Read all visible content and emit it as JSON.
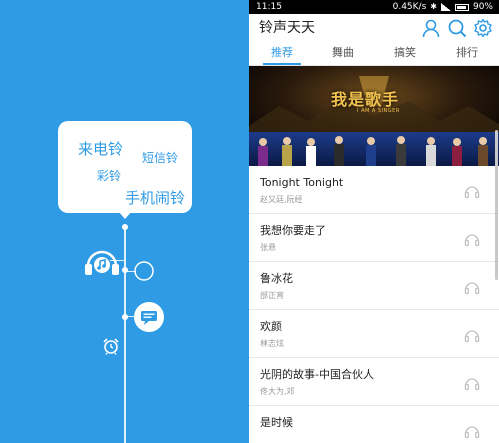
{
  "promo": {
    "bubble_words": [
      "来电铃",
      "短信铃",
      "彩铃",
      "手机闹铃"
    ]
  },
  "status_bar": {
    "time": "11:15",
    "network_speed": "0.45K/s",
    "battery": "90%"
  },
  "header": {
    "title": "铃声天天",
    "icons": [
      "user-icon",
      "search-icon",
      "gear-icon"
    ]
  },
  "tabs": [
    {
      "label": "推荐",
      "active": true
    },
    {
      "label": "舞曲",
      "active": false
    },
    {
      "label": "搞笑",
      "active": false
    },
    {
      "label": "排行",
      "active": false
    }
  ],
  "banner": {
    "logo_text": "我是歌手",
    "logo_subtext": "I AM A SINGER"
  },
  "songs": [
    {
      "title": "Tonight Tonight",
      "artist": "赵又廷,阮经"
    },
    {
      "title": "我想你要走了",
      "artist": "张悬"
    },
    {
      "title": "鲁冰花",
      "artist": "邰正宵"
    },
    {
      "title": "欢颜",
      "artist": "林志炫"
    },
    {
      "title": "光阴的故事-中国合伙人",
      "artist": "佟大为,邓"
    },
    {
      "title": "是时候",
      "artist": ""
    }
  ],
  "colors": {
    "accent": "#2f9be5",
    "promo_bg": "#2f9be5",
    "gold": "#f2c14e"
  }
}
